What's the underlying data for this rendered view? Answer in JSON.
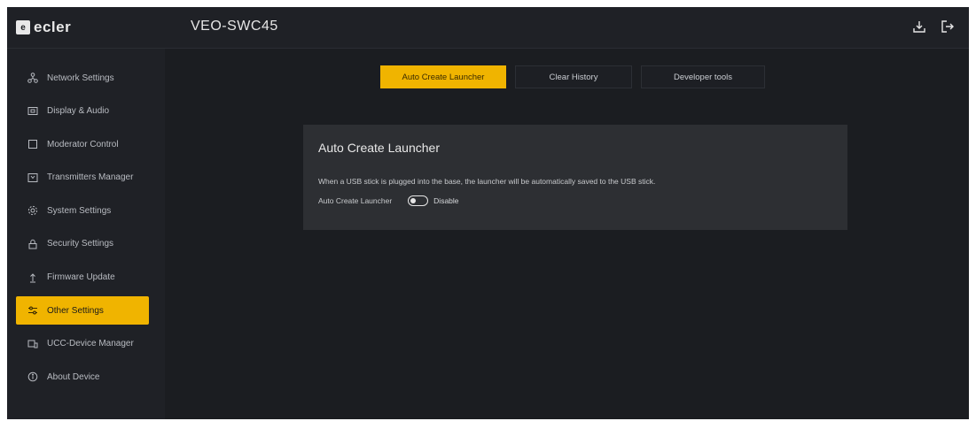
{
  "header": {
    "logo_text": "ecler",
    "logo_mark": "e",
    "device_name": "VEO-SWC45",
    "icons": [
      "download-icon",
      "logout-icon"
    ]
  },
  "sidebar": {
    "items": [
      {
        "label": "Network Settings",
        "icon": "network-icon",
        "active": false
      },
      {
        "label": "Display & Audio",
        "icon": "display-icon",
        "active": false
      },
      {
        "label": "Moderator Control",
        "icon": "moderator-icon",
        "active": false
      },
      {
        "label": "Transmitters Manager",
        "icon": "transmitter-icon",
        "active": false
      },
      {
        "label": "System Settings",
        "icon": "gear-icon",
        "active": false
      },
      {
        "label": "Security Settings",
        "icon": "lock-icon",
        "active": false
      },
      {
        "label": "Firmware Update",
        "icon": "upload-icon",
        "active": false
      },
      {
        "label": "Other Settings",
        "icon": "sliders-icon",
        "active": true
      },
      {
        "label": "UCC-Device Manager",
        "icon": "device-icon",
        "active": false
      },
      {
        "label": "About Device",
        "icon": "info-icon",
        "active": false
      }
    ]
  },
  "tabs": [
    {
      "label": "Auto Create Launcher",
      "active": true
    },
    {
      "label": "Clear History",
      "active": false
    },
    {
      "label": "Developer tools",
      "active": false
    }
  ],
  "panel": {
    "title": "Auto Create Launcher",
    "description": "When a USB stick is plugged into the base, the launcher will be automatically saved to the USB stick.",
    "setting_label": "Auto Create Launcher",
    "toggle_state": "Disable"
  },
  "colors": {
    "accent": "#f0b400",
    "background": "#1b1d21",
    "sidebar": "#1f2126",
    "panel": "#2d2f33"
  }
}
